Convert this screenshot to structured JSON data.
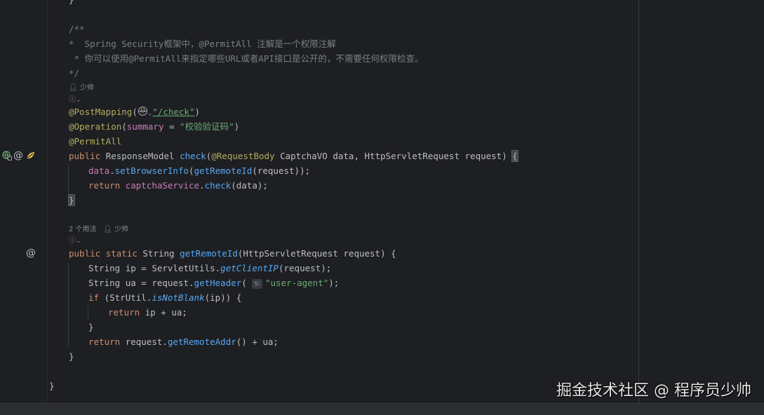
{
  "hints": {
    "author_1": "少帅",
    "usages_2": "2 个用法",
    "author_2": "少帅"
  },
  "code": {
    "l_close_top": "}",
    "c_open": "/**",
    "c_line1": "*  Spring Security框架中，@PermitAll 注解是一个权限注解",
    "c_line2": " * 你可以使用@PermitAll来指定哪些URL或者API接口是公开的，不需要任何权限检查。",
    "c_close": "*/",
    "post_mapping_ann": "@PostMapping",
    "open_paren": "(",
    "post_mapping_path": "\"/check\"",
    "close_paren": ")",
    "operation_ann": "@Operation",
    "summary_key": "summary",
    "eq": " = ",
    "summary_val": "\"校验验证码\"",
    "permitall_ann": "@PermitAll",
    "kw_public": "public",
    "type_response": "ResponseModel",
    "fn_check": "check",
    "ann_requestbody": "@RequestBody",
    "type_captcha": "CaptchaVO",
    "p_data": "data",
    "type_request": "HttpServletRequest",
    "p_request": "request",
    "brace_open": "{",
    "m1_obj": "data",
    "m1_call": "setBrowserInfo",
    "m1_inner": "getRemoteId",
    "m1_arg": "request",
    "m1_tail": "));",
    "kw_return": "return",
    "m2_obj": "captchaService",
    "m2_call": "check",
    "m2_arg": "data",
    "m2_tail": ");",
    "brace_close": "}",
    "kw_static": "static",
    "type_string": "String",
    "fn_getremoteid": "getRemoteId",
    "r1_var": "ip",
    "r1_cls": "ServletUtils",
    "r1_call": "getClientIP",
    "r1_arg": "request",
    "r2_var": "ua",
    "r2_obj": "request",
    "r2_call": "getHeader",
    "r2_inlay": "s:",
    "r2_str": "\"user-agent\"",
    "kw_if": "if",
    "r3_cls": "StrUtil",
    "r3_call": "isNotBlank",
    "r3_arg": "ip",
    "r4_expr": "ip + ua;",
    "r5_obj": "request",
    "r5_call": "getRemoteAddr",
    "r5_tail": "() + ua;",
    "class_close": "}"
  },
  "watermark": "掘金技术社区 @ 程序员少帅",
  "colors": {
    "background": "#1e1f22",
    "keyword": "#cf8e6d",
    "annotation": "#b3ae60",
    "string": "#6aab73",
    "method": "#56a8f5",
    "comment": "#7a7e85"
  }
}
